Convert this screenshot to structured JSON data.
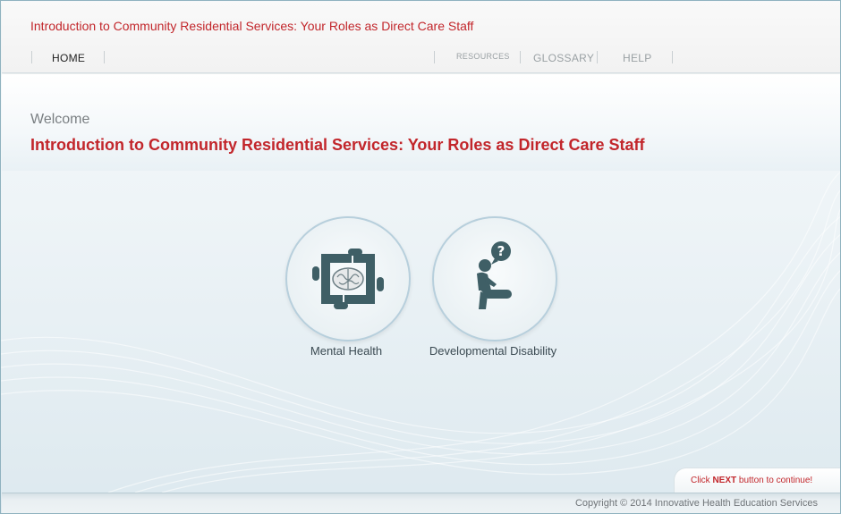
{
  "header": {
    "course_title": "Introduction to Community Residential Services: Your Roles as Direct Care Staff",
    "nav": {
      "home": "HOME",
      "resources": "RESOURCES",
      "glossary": "GLOSSARY",
      "help": "HELP"
    }
  },
  "main": {
    "welcome": "Welcome",
    "title": "Introduction to Community Residential Services: Your Roles as Direct Care Staff",
    "modules": [
      {
        "label": "Mental Health",
        "icon": "hands-brain-icon"
      },
      {
        "label": "Developmental Disability",
        "icon": "person-question-icon"
      }
    ]
  },
  "next_prompt": {
    "prefix": "Click ",
    "emphasis": "NEXT",
    "suffix": " button to continue!"
  },
  "footer": {
    "copyright": "Copyright © 2014 Innovative Health Education Services"
  },
  "colors": {
    "accent_red": "#c2262b",
    "icon_teal": "#3f5f66",
    "circle_border": "#b7cfdc"
  }
}
